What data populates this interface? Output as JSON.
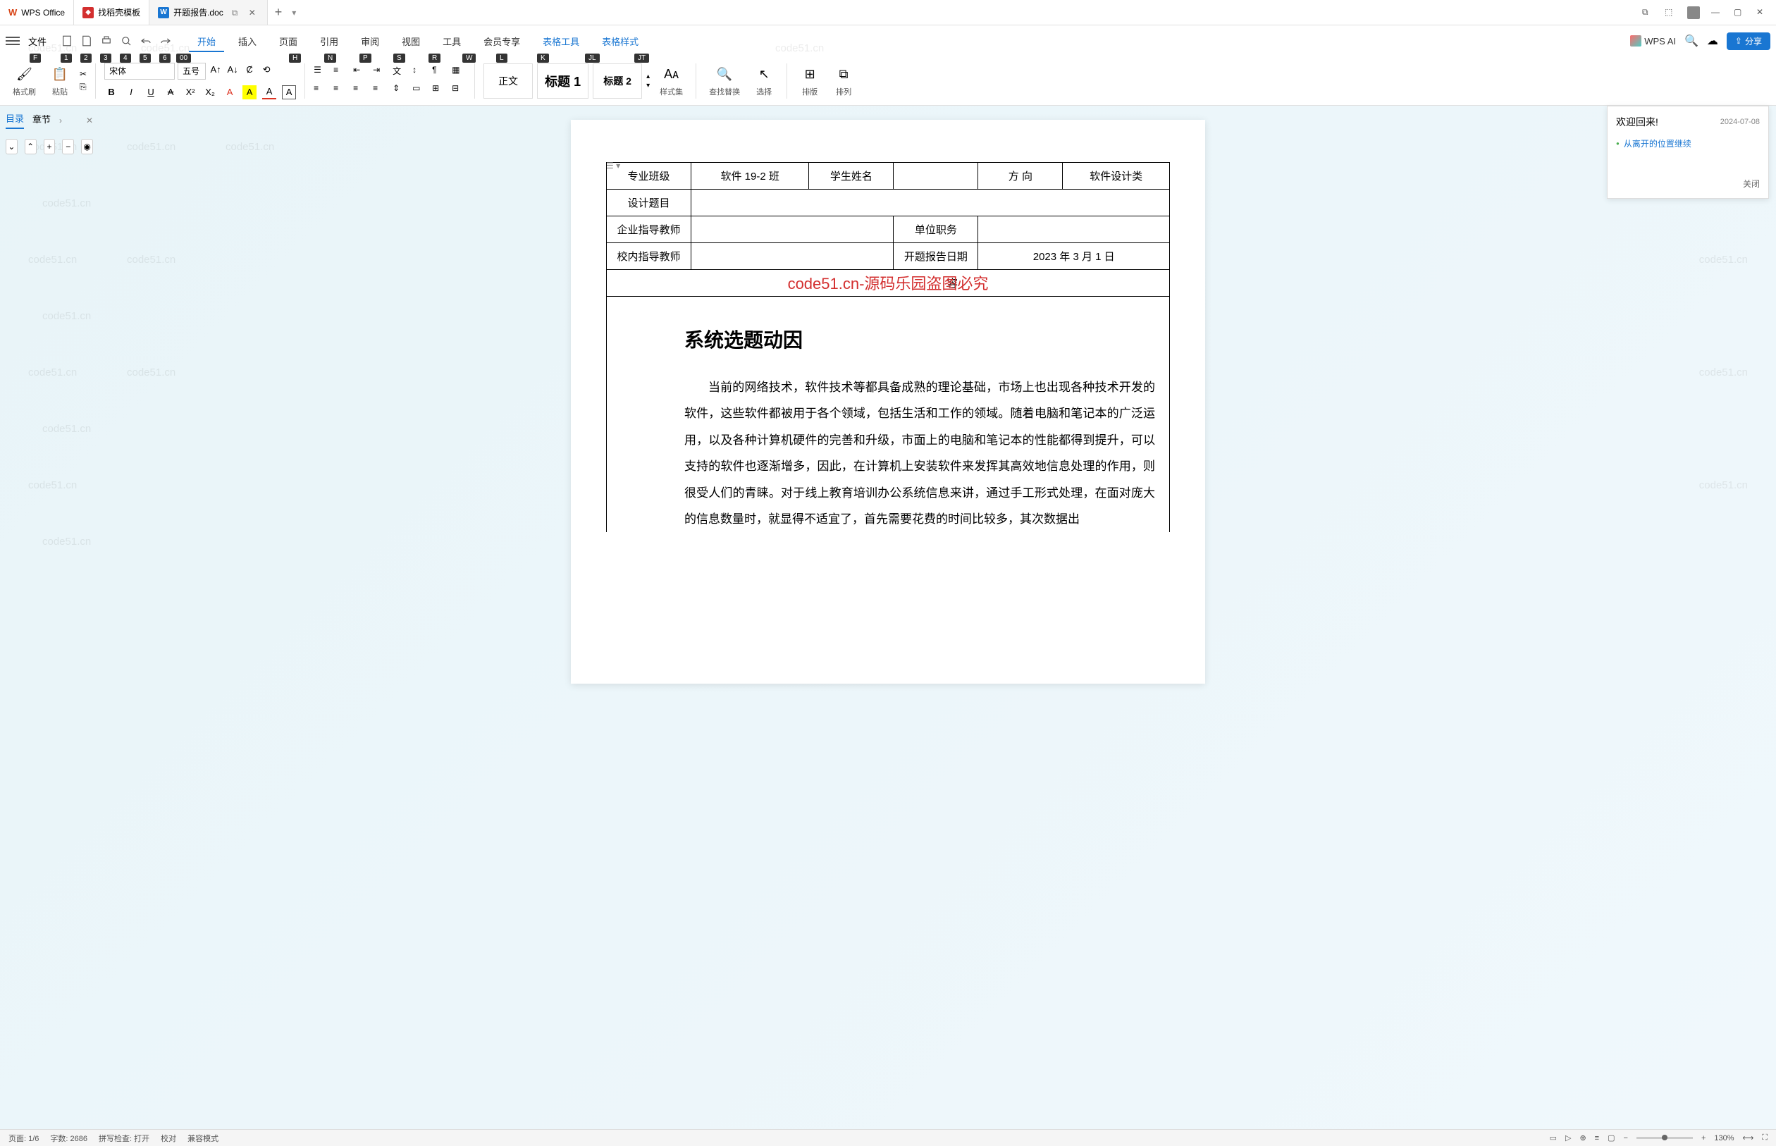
{
  "app": {
    "name": "WPS Office",
    "template_tab": "找稻壳模板",
    "doc_tab": "开题报告.doc"
  },
  "menu": {
    "file": "文件",
    "tabs": {
      "start": "开始",
      "insert": "插入",
      "page": "页面",
      "reference": "引用",
      "review": "审阅",
      "view": "视图",
      "tools": "工具",
      "member": "会员专享",
      "table_tools": "表格工具",
      "table_style": "表格样式"
    },
    "hints": {
      "file": "F",
      "q1": "1",
      "q2": "2",
      "q3": "3",
      "q4": "4",
      "q5": "5",
      "q6": "6",
      "q7": "00",
      "start": "H",
      "insert": "N",
      "page": "P",
      "reference": "S",
      "review": "R",
      "view": "W",
      "tools": "L",
      "member": "K",
      "table_tools": "JL",
      "table_style": "JT"
    },
    "wps_ai": "WPS AI",
    "share": "分享"
  },
  "ribbon": {
    "format_brush": "格式刷",
    "paste": "粘贴",
    "font_name": "宋体",
    "font_size": "五号",
    "styles": {
      "normal": "正文",
      "heading1": "标题 1",
      "heading2": "标题 2",
      "style_set": "样式集",
      "find_replace": "查找替换",
      "select": "选择",
      "layout": "排版",
      "arrange": "排列"
    }
  },
  "sidebar": {
    "toc": "目录",
    "chapter": "章节"
  },
  "welcome": {
    "title": "欢迎回来!",
    "date": "2024-07-08",
    "link": "从离开的位置继续",
    "close": "关闭"
  },
  "document": {
    "table": {
      "major_class": "专业班级",
      "major_class_val": "软件 19-2 班",
      "student_name": "学生姓名",
      "direction": "方      向",
      "direction_val": "软件设计类",
      "design_topic": "设计题目",
      "enterprise_teacher": "企业指导教师",
      "unit_position": "单位职务",
      "school_teacher": "校内指导教师",
      "report_date": "开题报告日期",
      "report_date_val": "2023 年 3 月 1 日",
      "content_label": "容"
    },
    "watermark": "code51.cn-源码乐园盗图必究",
    "heading": "系统选题动因",
    "body": "当前的网络技术，软件技术等都具备成熟的理论基础，市场上也出现各种技术开发的软件，这些软件都被用于各个领域，包括生活和工作的领域。随着电脑和笔记本的广泛运用，以及各种计算机硬件的完善和升级，市面上的电脑和笔记本的性能都得到提升，可以支持的软件也逐渐增多，因此，在计算机上安装软件来发挥其高效地信息处理的作用，则很受人们的青睐。对于线上教育培训办公系统信息来讲，通过手工形式处理，在面对庞大的信息数量时，就显得不适宜了，首先需要花费的时间比较多，其次数据出",
    "bg_wm": "code51.cn"
  },
  "statusbar": {
    "page": "页面: 1/6",
    "words": "字数: 2686",
    "spell_check": "拼写检查: 打开",
    "proofread": "校对",
    "compat_mode": "兼容模式",
    "zoom": "130%"
  }
}
